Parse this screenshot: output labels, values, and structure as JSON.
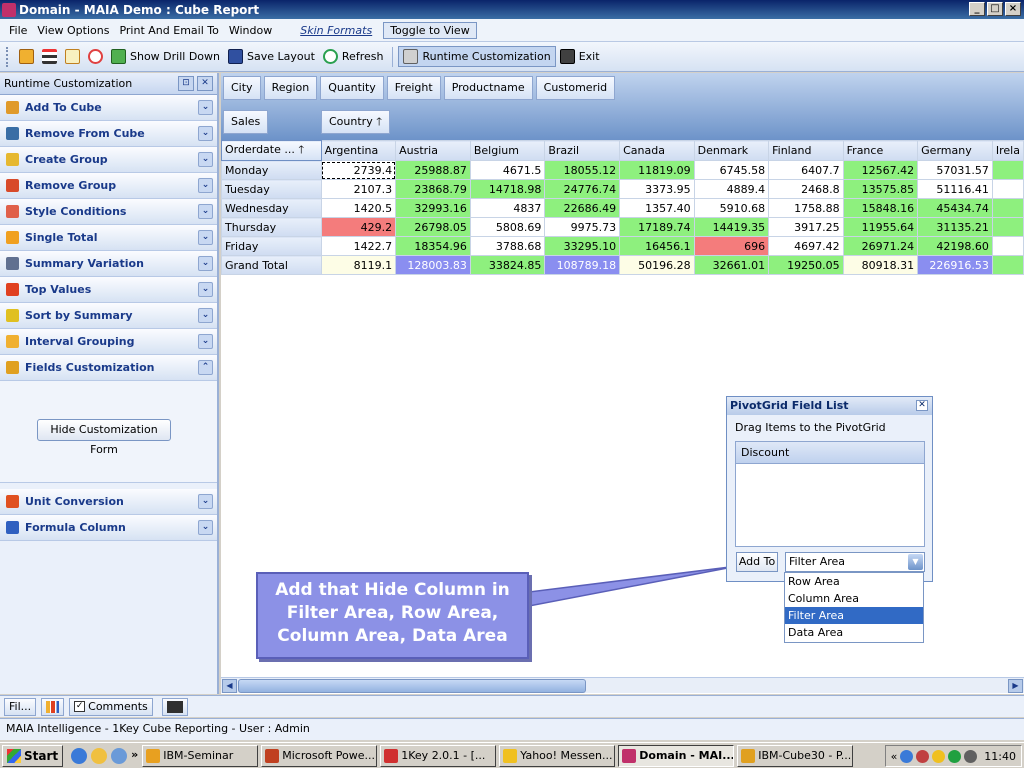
{
  "window": {
    "title": "Domain - MAIA Demo : Cube Report",
    "controls": [
      "_",
      "□",
      "×"
    ]
  },
  "menu": {
    "items": [
      "File",
      "View Options",
      "Print And Email To",
      "Window"
    ],
    "skin_formats": "Skin Formats",
    "toggle_view": "Toggle to View"
  },
  "toolbar": {
    "show_drill_down": "Show Drill Down",
    "save_layout": "Save Layout",
    "refresh": "Refresh",
    "runtime_customization": "Runtime Customization",
    "exit": "Exit"
  },
  "left_panel": {
    "header": "Runtime Customization",
    "items_top": [
      {
        "label": "Add To Cube",
        "icon": "cube-add-icon",
        "color": "#e09a2a"
      },
      {
        "label": "Remove From Cube",
        "icon": "cube-remove-icon",
        "color": "#3a6ea5"
      },
      {
        "label": "Create Group",
        "icon": "group-create-icon",
        "color": "#e6b830"
      },
      {
        "label": "Remove Group",
        "icon": "group-remove-icon",
        "color": "#d84a2a"
      },
      {
        "label": "Style Conditions",
        "icon": "style-icon",
        "color": "#e0604a"
      },
      {
        "label": "Single Total",
        "icon": "total-icon",
        "color": "#f0a020"
      },
      {
        "label": "Summary Variation",
        "icon": "summary-icon",
        "color": "#607090"
      },
      {
        "label": "Top Values",
        "icon": "top-values-icon",
        "color": "#e04020"
      },
      {
        "label": "Sort by Summary",
        "icon": "sort-icon",
        "color": "#e0c020"
      },
      {
        "label": "Interval Grouping",
        "icon": "interval-icon",
        "color": "#f0b030"
      },
      {
        "label": "Fields Customization",
        "icon": "fields-icon",
        "color": "#e0a020"
      }
    ],
    "hide_button": "Hide Customization Form",
    "items_bottom": [
      {
        "label": "Unit Conversion",
        "icon": "unit-icon",
        "color": "#e05020"
      },
      {
        "label": "Formula Column",
        "icon": "sigma-icon",
        "color": "#3060c0"
      }
    ]
  },
  "pivot": {
    "filter_fields": [
      "City",
      "Region",
      "Quantity",
      "Freight",
      "Productname",
      "Customerid"
    ],
    "data_field": "Sales",
    "column_field": "Country",
    "row_field": "Orderdate ...",
    "columns": [
      "Argentina",
      "Austria",
      "Belgium",
      "Brazil",
      "Canada",
      "Denmark",
      "Finland",
      "France",
      "Germany",
      "Irela"
    ],
    "rows": [
      {
        "label": "Monday",
        "values": [
          "2739.4",
          "25988.87",
          "4671.5",
          "18055.12",
          "11819.09",
          "6745.58",
          "6407.7",
          "12567.42",
          "57031.57",
          ""
        ],
        "colors": [
          "",
          "g",
          "",
          "g",
          "g",
          "",
          "",
          "g",
          "",
          "g"
        ]
      },
      {
        "label": "Tuesday",
        "values": [
          "2107.3",
          "23868.79",
          "14718.98",
          "24776.74",
          "3373.95",
          "4889.4",
          "2468.8",
          "13575.85",
          "51116.41",
          ""
        ],
        "colors": [
          "",
          "g",
          "g",
          "g",
          "",
          "",
          "",
          "g",
          "",
          ""
        ]
      },
      {
        "label": "Wednesday",
        "values": [
          "1420.5",
          "32993.16",
          "4837",
          "22686.49",
          "1357.40",
          "5910.68",
          "1758.88",
          "15848.16",
          "45434.74",
          ""
        ],
        "colors": [
          "",
          "g",
          "",
          "g",
          "",
          "",
          "",
          "g",
          "g",
          "g"
        ]
      },
      {
        "label": "Thursday",
        "values": [
          "429.2",
          "26798.05",
          "5808.69",
          "9975.73",
          "17189.74",
          "14419.35",
          "3917.25",
          "11955.64",
          "31135.21",
          ""
        ],
        "colors": [
          "r",
          "g",
          "",
          "",
          "g",
          "g",
          "",
          "g",
          "g",
          "g"
        ]
      },
      {
        "label": "Friday",
        "values": [
          "1422.7",
          "18354.96",
          "3788.68",
          "33295.10",
          "16456.1",
          "696",
          "4697.42",
          "26971.24",
          "42198.60",
          ""
        ],
        "colors": [
          "",
          "g",
          "",
          "g",
          "g",
          "r",
          "",
          "g",
          "g",
          ""
        ]
      },
      {
        "label": "Grand Total",
        "values": [
          "8119.1",
          "128003.83",
          "33824.85",
          "108789.18",
          "50196.28",
          "32661.01",
          "19250.05",
          "80918.31",
          "226916.53",
          ""
        ],
        "colors": [
          "y",
          "b",
          "g",
          "b",
          "y",
          "g",
          "g",
          "y",
          "b",
          "g"
        ]
      }
    ]
  },
  "field_list": {
    "title": "PivotGrid Field List",
    "subtitle": "Drag Items to the PivotGrid",
    "items": [
      "Discount"
    ],
    "add_to": "Add To",
    "selected_area": "Filter Area",
    "options": [
      "Row Area",
      "Column Area",
      "Filter Area",
      "Data Area"
    ]
  },
  "callout": {
    "text": "Add that Hide Column in Filter Area, Row Area, Column Area, Data Area"
  },
  "bottom_tabs": {
    "fil": "Fil...",
    "comments": "Comments"
  },
  "status": "MAIA Intelligence - 1Key Cube Reporting - User : Admin",
  "taskbar": {
    "start": "Start",
    "tasks": [
      "IBM-Seminar",
      "Microsoft Powe...",
      "1Key 2.0.1 - [...",
      "Yahoo! Messen...",
      "Domain - MAI...",
      "IBM-Cube30 - P..."
    ],
    "tray_prefix": "«",
    "clock": "11:40"
  }
}
